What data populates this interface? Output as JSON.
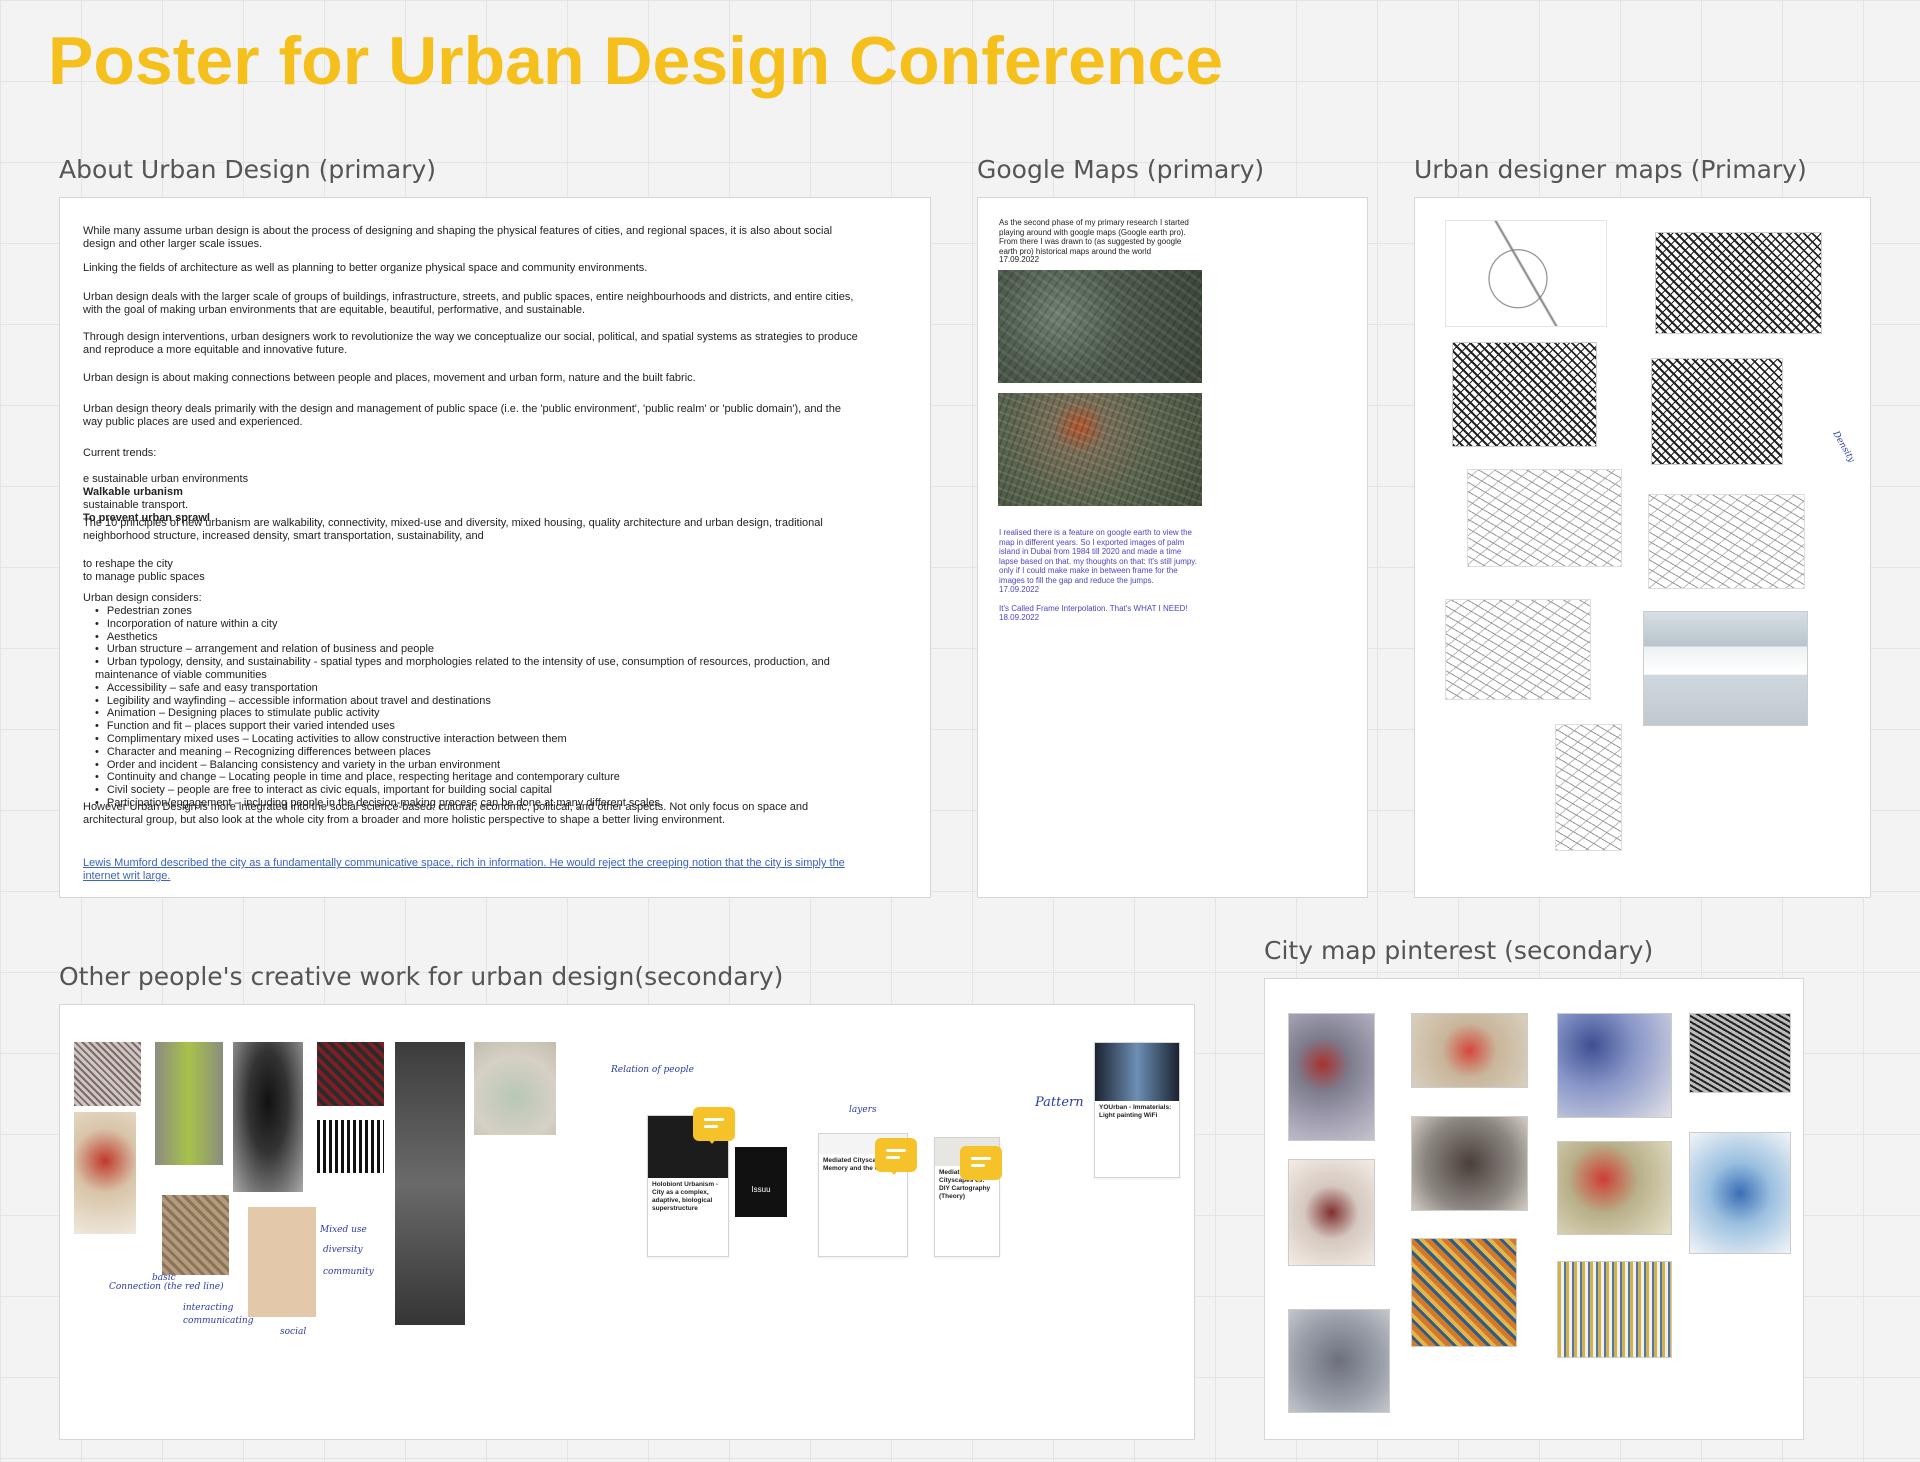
{
  "board_title": "Poster for Urban Design Conference",
  "sections": {
    "about": "About Urban Design (primary)",
    "google": "Google Maps (primary)",
    "designer": "Urban designer maps (Primary)",
    "others": "Other people's creative work for urban design(secondary)",
    "pinterest": "City map pinterest (secondary)"
  },
  "about": {
    "p1": "While many assume urban design is about the process of designing and shaping the physical features of cities, and regional spaces, it is also about social design and other larger scale issues.",
    "p2": "Linking the fields of architecture as well as planning to better organize physical space and community environments.",
    "p3": "Urban design deals with the larger scale of groups of buildings, infrastructure, streets, and public spaces, entire neighbourhoods and districts, and entire cities, with the goal of making urban environments that are equitable, beautiful, performative, and sustainable.",
    "p4": "Through design interventions, urban designers work to revolutionize the way we conceptualize our social, political, and spatial systems as strategies to produce and reproduce a more equitable and innovative future.",
    "p5": "Urban design is about making connections between people and places, movement and urban form, nature and the built fabric.",
    "p6": "Urban design theory deals primarily with the design and management of public space (i.e. the 'public environment', 'public realm' or 'public domain'), and the way public places are used and experienced.",
    "trends_label": "Current trends:",
    "trend1": "e sustainable urban environments",
    "trend2": "Walkable urbanism",
    "trend3": "sustainable transport.",
    "trend4": "To prevent urban sprawl",
    "p7": "The 10 principles of new urbanism are walkability, connectivity, mixed-use and diversity, mixed housing, quality architecture and urban design, traditional neighborhood structure, increased density, smart transportation, sustainability, and",
    "reshape": "to reshape the city",
    "manage": "to manage public spaces",
    "considers": "Urban design considers:",
    "list": [
      "Pedestrian zones",
      "Incorporation of nature within a city",
      "Aesthetics",
      "Urban structure – arrangement and relation of business and people",
      "Urban typology, density, and sustainability - spatial types and morphologies related to the intensity of use, consumption of resources, production, and maintenance of viable communities",
      "Accessibility – safe and easy transportation",
      "Legibility and wayfinding – accessible information about travel and destinations",
      "Animation – Designing places to stimulate public activity",
      "Function and fit – places support their varied intended uses",
      "Complimentary mixed uses – Locating activities to allow constructive interaction between them",
      "Character and meaning – Recognizing differences between places",
      "Order and incident – Balancing consistency and variety in the urban environment",
      "Continuity and change – Locating people in time and place, respecting heritage and contemporary culture",
      "Civil society – people are free to interact as civic equals, important for building social capital",
      "Participation/engagement – including people in the decision-making process can be done at many different scales."
    ],
    "p8": "However Urban Design is more integrated into the social science-based: cultural, economic, political, and other aspects. Not only focus on space and architectural group, but also look at the whole city from a broader and more holistic perspective to shape a better living environment.",
    "link": "Lewis Mumford described the city as a fundamentally communicative space, rich in information. He would reject the creeping notion that the city is simply the internet writ large."
  },
  "google": {
    "intro": "As the second phase of my primary research I started playing around with google maps (Google earth pro). From there I was drawn to (as suggested by google earth pro) historical maps around the world",
    "date1": "17.09.2022",
    "note": "I realised there is a feature on google earth to view the map in different years. So I exported images of palm island in Dubai from 1984 till 2020 and made a time lapse based on that. my thoughts on that: It's still jumpy. only if I could make make in between frame for the images to fill the gap and reduce the jumps.",
    "date2": "17.09.2022",
    "note2": "It's Called Frame Interpolation. That's WHAT I NEED!",
    "date3": "18.09.2022"
  },
  "designer_notes": {
    "density": "Density"
  },
  "others": {
    "card1_title": "Holobiont Urbanism - City as a complex, adaptive, biological superstructure",
    "card2_title": "Mediated Cityscapes 02: Memory and the City",
    "card3_title": "Mediated Cityscapes 03: DIY Cartography (Theory)",
    "card4_title": "YOUrban - Immaterials: Light painting WiFi",
    "hand_label": "Pattern",
    "hand_rel": "Relation of people",
    "hand_layers": "layers",
    "hand_connection": "Connection (the red line)",
    "hand_basic": "basic",
    "hand_interacting": "interacting",
    "hand_communicating": "communicating",
    "hand_mixed": "Mixed use",
    "hand_diversity": "diversity",
    "hand_community": "community",
    "hand_social": "social",
    "issuu": "Issuu"
  },
  "colors": {
    "title": "#f5c01b",
    "comment": "#f6c229",
    "handwriting": "#2a3aa8",
    "link": "#3b62c4"
  }
}
